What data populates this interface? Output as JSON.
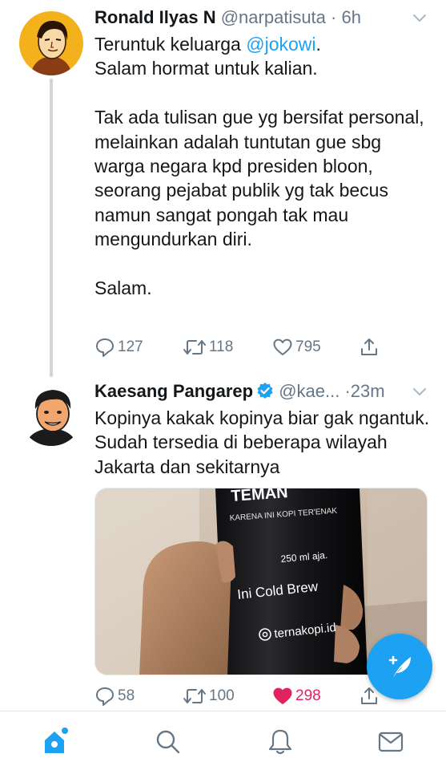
{
  "tweets": [
    {
      "name": "Ronald Ilyas N",
      "handle": "@narpatisuta",
      "dot": "·",
      "time": "6h",
      "text_line1": "Teruntuk keluarga ",
      "mention": "@jokowi",
      "text_line1_end": ".",
      "text_rest": "Salam hormat untuk kalian.\n\nTak ada tulisan gue yg bersifat personal,\nmelainkan adalah tuntutan gue sbg warga negara kpd presiden bloon, seorang pejabat publik yg tak becus namun sangat pongah tak mau mengundurkan diri.\n\nSalam.",
      "replies": "127",
      "retweets": "118",
      "likes": "795",
      "liked": false
    },
    {
      "name": "Kaesang Pangarep",
      "handle": "@kae...",
      "dot": "·",
      "time": "23m",
      "text": "Kopinya kakak kopinya biar gak ngantuk. Sudah tersedia di beberapa wilayah Jakarta dan sekitarnya",
      "replies": "58",
      "retweets": "100",
      "likes": "298",
      "liked": true,
      "verified": true,
      "media": {
        "bottle_top": "TEMAN",
        "tagline": "KARENA INI KOPI TER'ENAK",
        "volume": "250 ml aja.",
        "product": "Ini Cold Brew",
        "instagram": "ternakopi.id"
      }
    }
  ],
  "tabbar": {
    "items": [
      "home-icon",
      "search-icon",
      "notifications-icon",
      "messages-icon"
    ],
    "active": "home-icon"
  },
  "fab": {
    "icon": "compose-tweet-icon"
  },
  "colors": {
    "accent": "#1da1f2",
    "like": "#e0245e",
    "muted": "#657786",
    "text": "#14171a"
  }
}
